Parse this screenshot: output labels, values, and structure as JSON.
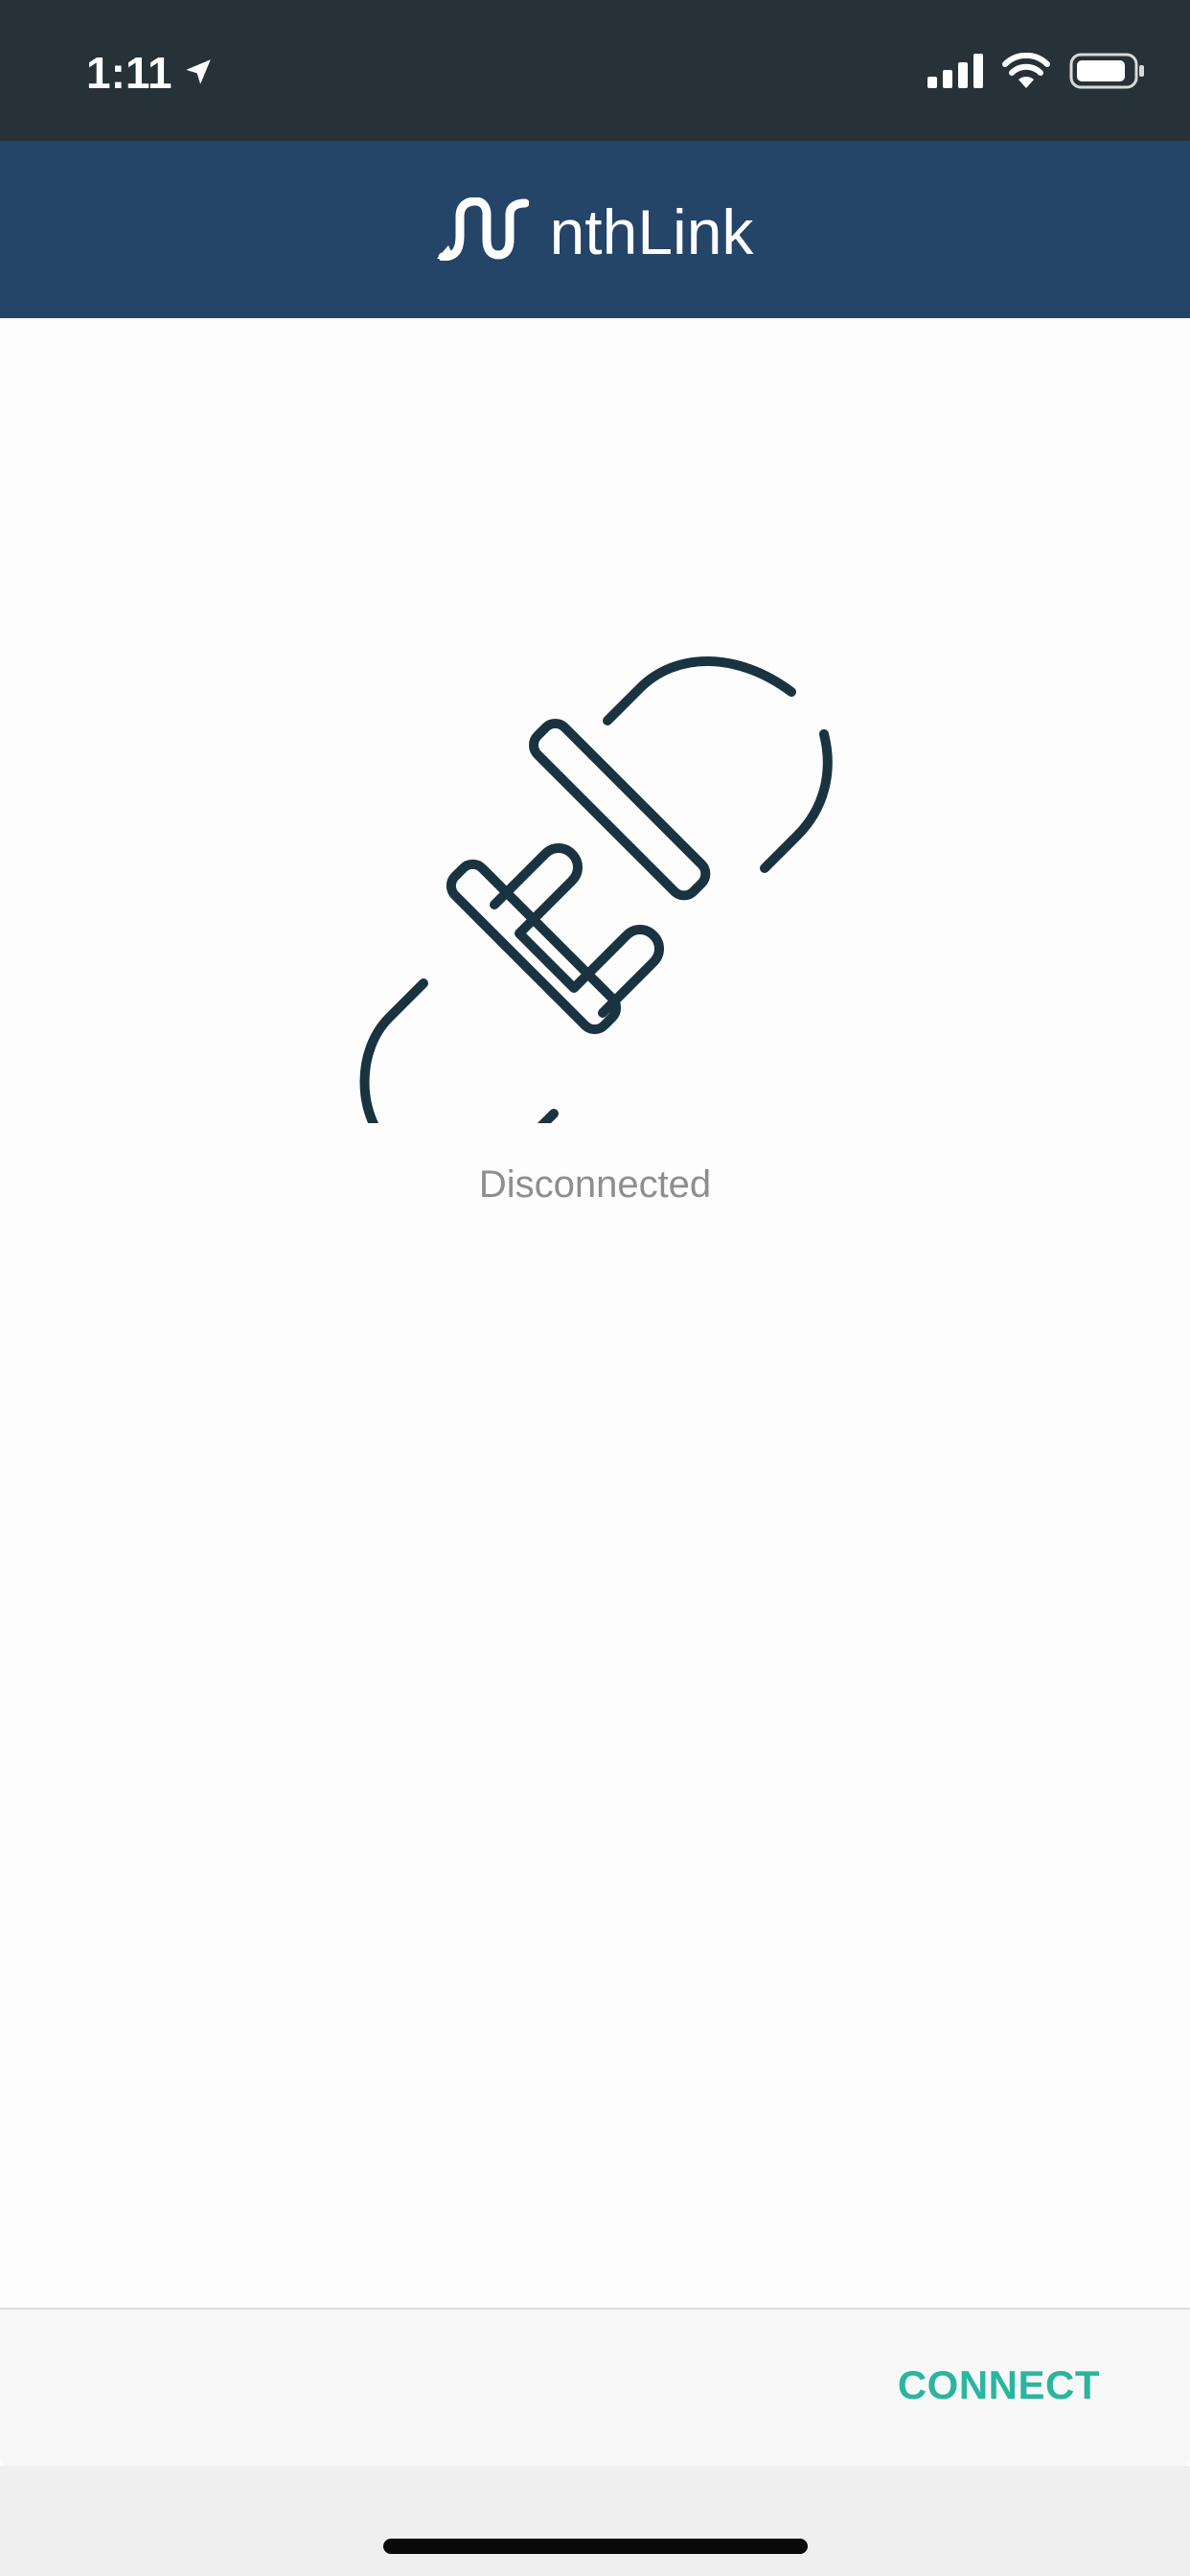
{
  "status_bar": {
    "time": "1:11",
    "location_icon": "location-arrow-icon",
    "signal_icon": "cellular-signal-icon",
    "wifi_icon": "wifi-icon",
    "battery_icon": "battery-icon"
  },
  "header": {
    "logo_icon": "nthlink-logo-icon",
    "app_name": "nthLink",
    "background_color": "#244468"
  },
  "main": {
    "illustration_icon": "disconnected-plug-icon",
    "status": "Disconnected"
  },
  "action_bar": {
    "connect_label": "CONNECT",
    "accent_color": "#2bb5a0"
  }
}
